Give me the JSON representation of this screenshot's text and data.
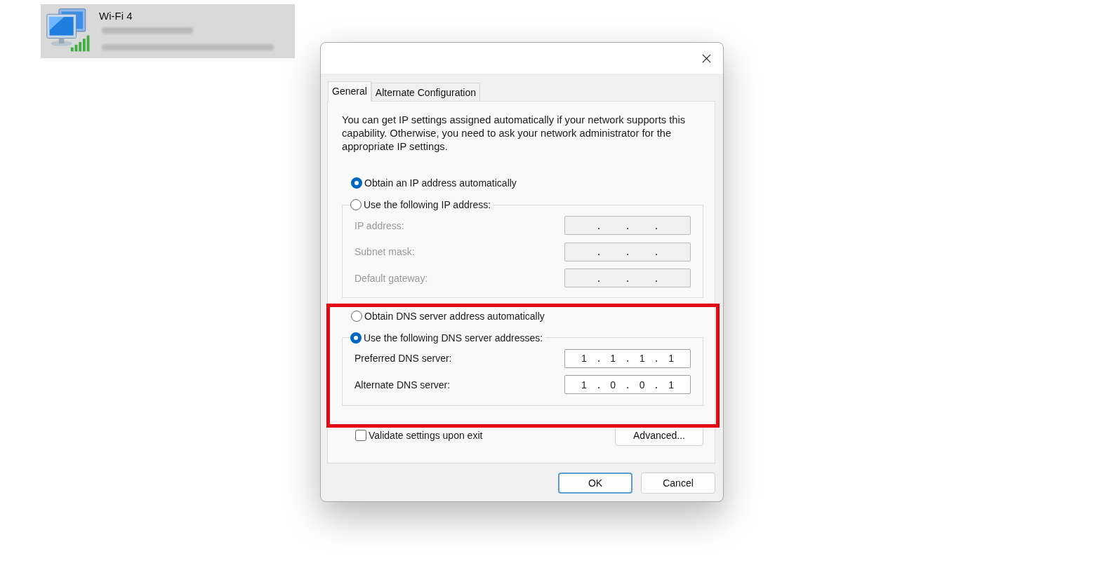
{
  "connection_card": {
    "name": "Wi-Fi 4"
  },
  "dialog": {
    "tabs": [
      {
        "label": "General",
        "selected": true
      },
      {
        "label": "Alternate Configuration",
        "selected": false
      }
    ],
    "description": "You can get IP settings assigned automatically if your network supports this capability. Otherwise, you need to ask your network administrator for the appropriate IP settings.",
    "ip_mode": [
      {
        "label": "Obtain an IP address automatically",
        "selected": true
      },
      {
        "label": "Use the following IP address:",
        "selected": false
      }
    ],
    "ip_fields": [
      {
        "label": "IP address:",
        "disabled": true
      },
      {
        "label": "Subnet mask:",
        "disabled": true
      },
      {
        "label": "Default gateway:",
        "disabled": true
      }
    ],
    "dns_mode": [
      {
        "label": "Obtain DNS server address automatically",
        "selected": false
      },
      {
        "label": "Use the following DNS server addresses:",
        "selected": true
      }
    ],
    "dns_fields": [
      {
        "label": "Preferred DNS server:",
        "disabled": false,
        "octets": [
          "1",
          "1",
          "1",
          "1"
        ]
      },
      {
        "label": "Alternate DNS server:",
        "disabled": false,
        "octets": [
          "1",
          "0",
          "0",
          "1"
        ]
      }
    ],
    "validate": {
      "label": "Validate settings upon exit",
      "checked": false
    },
    "advanced_button": "Advanced...",
    "buttons": [
      {
        "label": "OK",
        "default": true
      },
      {
        "label": "Cancel",
        "default": false
      }
    ]
  }
}
